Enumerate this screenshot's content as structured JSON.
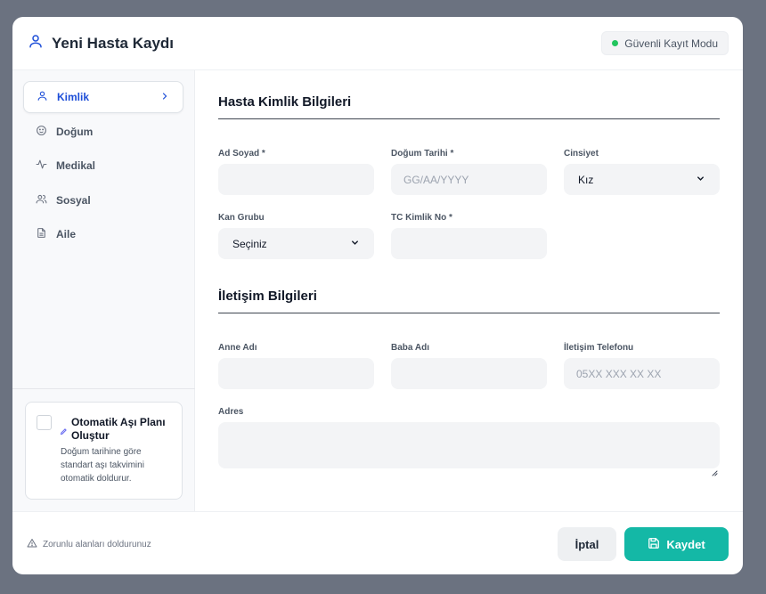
{
  "header": {
    "title": "Yeni Hasta Kaydı",
    "mode_badge": "Güvenli Kayıt Modu",
    "mode_color": "#22c55e"
  },
  "sidebar": {
    "items": [
      {
        "label": "Kimlik",
        "icon": "user-icon",
        "active": true
      },
      {
        "label": "Doğum",
        "icon": "baby-icon",
        "active": false
      },
      {
        "label": "Medikal",
        "icon": "activity-icon",
        "active": false
      },
      {
        "label": "Sosyal",
        "icon": "users-icon",
        "active": false
      },
      {
        "label": "Aile",
        "icon": "document-icon",
        "active": false
      }
    ],
    "auto_plan": {
      "checked": false,
      "title": "Otomatik Aşı Planı Oluştur",
      "description": "Doğum tarihine göre standart aşı takvimini otomatik doldurur."
    }
  },
  "identity": {
    "title": "Hasta Kimlik Bilgileri",
    "name_label": "Ad Soyad *",
    "name_value": "",
    "birth_label": "Doğum Tarihi *",
    "birth_placeholder": "GG/AA/YYYY",
    "gender_label": "Cinsiyet",
    "gender_value": "Kız",
    "blood_label": "Kan Grubu",
    "blood_value": "Seçiniz",
    "tc_label": "TC Kimlik No *",
    "tc_value": ""
  },
  "contact": {
    "title": "İletişim Bilgileri",
    "mother_label": "Anne Adı",
    "mother_value": "",
    "father_label": "Baba Adı",
    "father_value": "",
    "phone_label": "İletişim Telefonu",
    "phone_placeholder": "05XX XXX XX XX",
    "address_label": "Adres",
    "address_value": ""
  },
  "footer": {
    "note": "Zorunlu alanları doldurunuz",
    "cancel_label": "İptal",
    "save_label": "Kaydet"
  },
  "colors": {
    "accent": "#1d4ed8",
    "save": "#14b8a6"
  }
}
